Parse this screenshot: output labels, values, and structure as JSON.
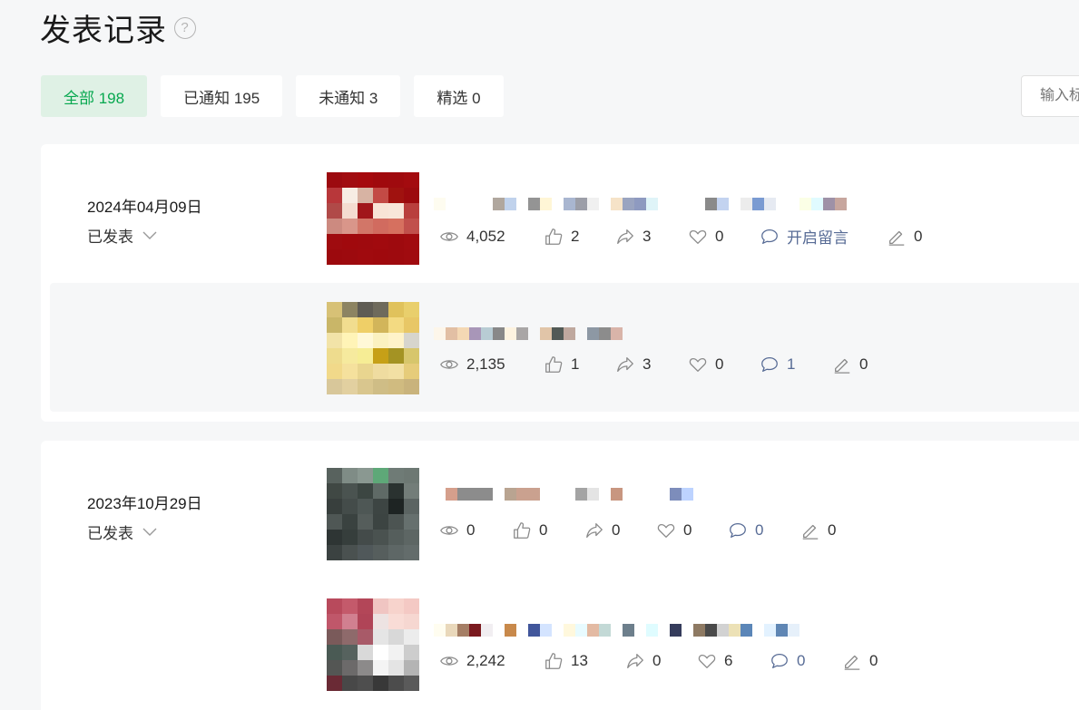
{
  "header": {
    "title": "发表记录",
    "help": "?"
  },
  "filters": [
    {
      "label": "全部 198",
      "active": true
    },
    {
      "label": "已通知 195",
      "active": false
    },
    {
      "label": "未通知 3",
      "active": false
    },
    {
      "label": "精选 0",
      "active": false
    }
  ],
  "search": {
    "placeholder": "输入标题"
  },
  "groups": [
    {
      "date": "2024年04月09日",
      "status": "已发表",
      "articles": [
        {
          "views": "4,052",
          "likes": "2",
          "shares": "3",
          "favs": "0",
          "comments": "开启留言",
          "edits": "0"
        },
        {
          "views": "2,135",
          "likes": "1",
          "shares": "3",
          "favs": "0",
          "comments": "1",
          "edits": "0"
        }
      ]
    },
    {
      "date": "2023年10月29日",
      "status": "已发表",
      "articles": [
        {
          "views": "0",
          "likes": "0",
          "shares": "0",
          "favs": "0",
          "comments": "0",
          "edits": "0"
        },
        {
          "views": "2,242",
          "likes": "13",
          "shares": "0",
          "favs": "6",
          "comments": "0",
          "edits": "0"
        }
      ]
    }
  ],
  "colors": {
    "accent": "#07a84f",
    "accent_bg": "#dff1e5",
    "link": "#576b95",
    "icon": "#8a8a8a"
  }
}
